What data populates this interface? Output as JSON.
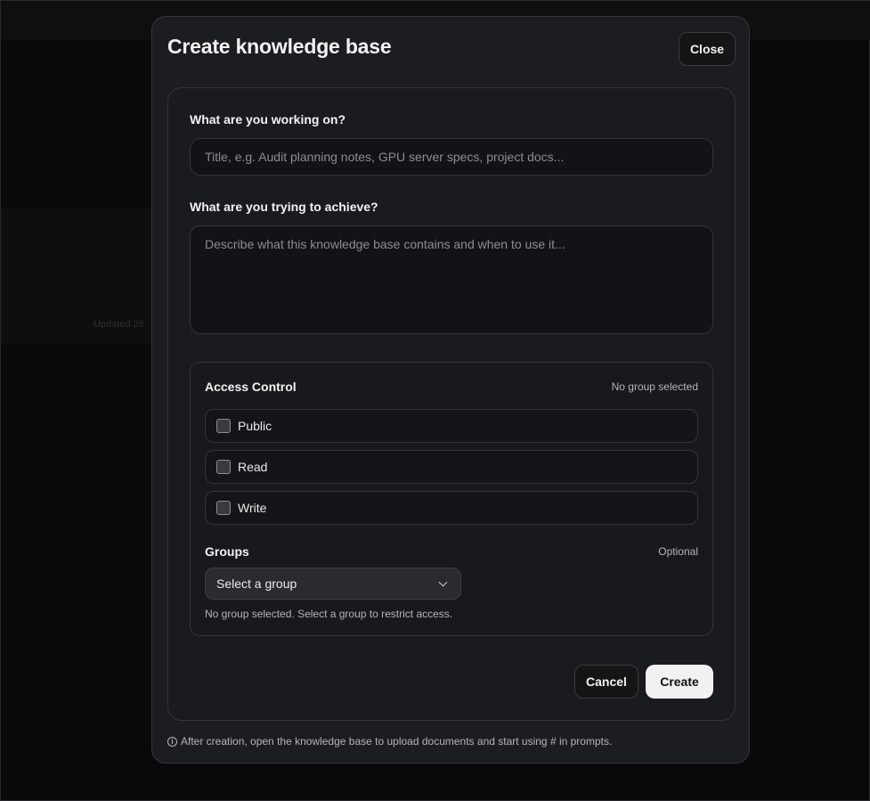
{
  "background": {
    "faint_text": "Updated 26"
  },
  "modal": {
    "title": "Create knowledge base",
    "close_label": "Close"
  },
  "form": {
    "working_on_label": "What are you working on?",
    "title_placeholder": "Title, e.g. Audit planning notes, GPU server specs, project docs...",
    "title_value": "",
    "achieve_label": "What are you trying to achieve?",
    "description_placeholder": "Describe what this knowledge base contains and when to use it...",
    "description_value": ""
  },
  "access_control": {
    "title": "Access Control",
    "status": "No group selected",
    "permissions": [
      {
        "label": "Public",
        "checked": false
      },
      {
        "label": "Read",
        "checked": false
      },
      {
        "label": "Write",
        "checked": false
      }
    ],
    "groups_title": "Groups",
    "groups_optional": "Optional",
    "group_select_value": "Select a group",
    "group_hint": "No group selected. Select a group to restrict access."
  },
  "actions": {
    "cancel_label": "Cancel",
    "create_label": "Create"
  },
  "footer": {
    "icon": "info-icon",
    "note": "After creation, open the knowledge base to upload documents and start using # in prompts."
  },
  "colors": {
    "modal_bg": "#1c1d21",
    "primary_button": "#f1f1f3"
  }
}
